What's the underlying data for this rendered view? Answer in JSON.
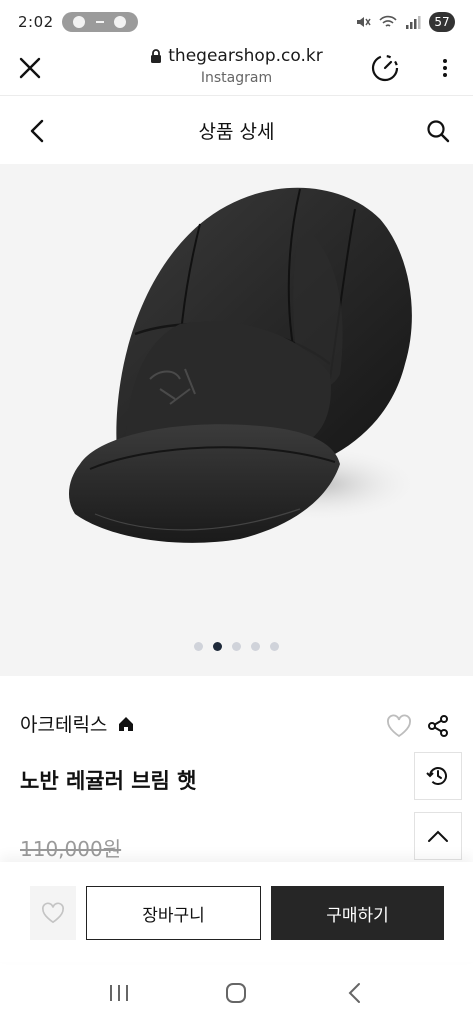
{
  "status_bar": {
    "time": "2:02",
    "battery": "57"
  },
  "browser": {
    "url": "thegearshop.co.kr",
    "source": "Instagram"
  },
  "header": {
    "title": "상품 상세"
  },
  "carousel": {
    "count": 5,
    "active_index": 1
  },
  "product": {
    "brand": "아크테릭스",
    "name": "노반 레귤러 브림 햇",
    "original_price": "110,000원"
  },
  "actions": {
    "cart_label": "장바구니",
    "buy_label": "구매하기"
  },
  "icons": {
    "close": "close-icon",
    "lock": "lock-icon",
    "timer": "timer-icon",
    "more": "more-vertical-icon",
    "back": "chevron-left-icon",
    "search": "search-icon",
    "home": "home-icon",
    "heart": "heart-icon",
    "share": "share-icon",
    "history": "history-icon",
    "scroll_top": "chevron-up-icon"
  },
  "colors": {
    "buy_button": "#262626",
    "active_dot": "#1f2a3a",
    "image_background": "#f4f4f4"
  }
}
